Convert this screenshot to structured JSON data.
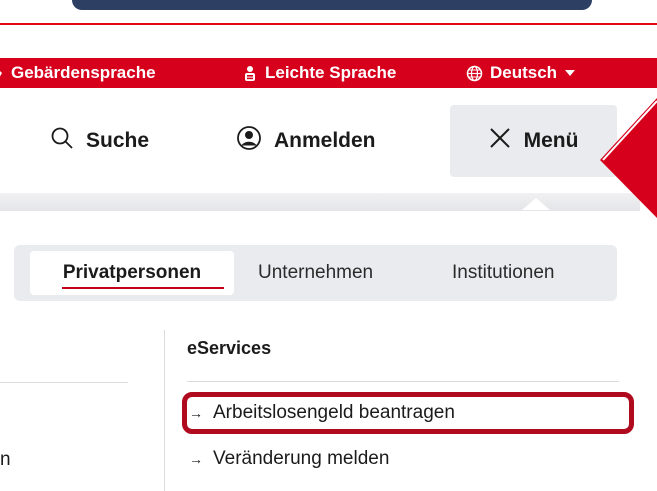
{
  "accessibility_bar": {
    "sign_language": "Gebärdensprache",
    "easy_language": "Leichte Sprache",
    "language": "Deutsch"
  },
  "header": {
    "search_label": "Suche",
    "login_label": "Anmelden",
    "menu_label": "Menü"
  },
  "menu": {
    "tabs": [
      {
        "label": "Privatpersonen",
        "active": true
      },
      {
        "label": "Unternehmen",
        "active": false
      },
      {
        "label": "Institutionen",
        "active": false
      }
    ],
    "left_fragment": "n",
    "section_title": "eServices",
    "links": [
      {
        "label": "Arbeitslosengeld beantragen",
        "highlighted": true
      },
      {
        "label": "Veränderung melden",
        "highlighted": false
      }
    ]
  },
  "colors": {
    "brand_red": "#d6001c",
    "highlight_border": "#b00a1e",
    "tab_bg": "#eaebee"
  },
  "icons": [
    "hands-icon",
    "easy-language-icon",
    "globe-icon",
    "dropdown-caret-icon",
    "search-icon",
    "user-icon",
    "close-icon",
    "arrow-right-icon"
  ]
}
